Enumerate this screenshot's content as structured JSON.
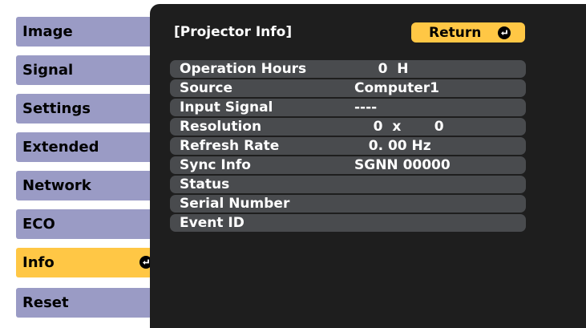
{
  "sidebar": {
    "items": [
      {
        "label": "Image"
      },
      {
        "label": "Signal"
      },
      {
        "label": "Settings"
      },
      {
        "label": "Extended"
      },
      {
        "label": "Network"
      },
      {
        "label": "ECO"
      },
      {
        "label": "Info"
      },
      {
        "label": "Reset"
      }
    ],
    "active_index": 6
  },
  "panel": {
    "title": "[Projector Info]",
    "return_label": "Return",
    "rows": [
      {
        "label": "Operation Hours",
        "value": "     0  H"
      },
      {
        "label": "Source",
        "value": "Computer1"
      },
      {
        "label": "Input Signal",
        "value": "----"
      },
      {
        "label": "Resolution",
        "value": "    0  x       0"
      },
      {
        "label": "Refresh Rate",
        "value": "   0. 00 Hz"
      },
      {
        "label": "Sync Info",
        "value": "SGNN 00000"
      },
      {
        "label": "Status",
        "value": ""
      },
      {
        "label": "Serial Number",
        "value": ""
      },
      {
        "label": "Event ID",
        "value": ""
      }
    ]
  },
  "colors": {
    "menu_item": "#9a9bc5",
    "menu_item_active": "#ffc745",
    "panel_bg": "#1e1e1e",
    "row_bg": "#494b4e",
    "button": "#ffc745"
  },
  "icons": {
    "enter": "enter-return-icon"
  }
}
